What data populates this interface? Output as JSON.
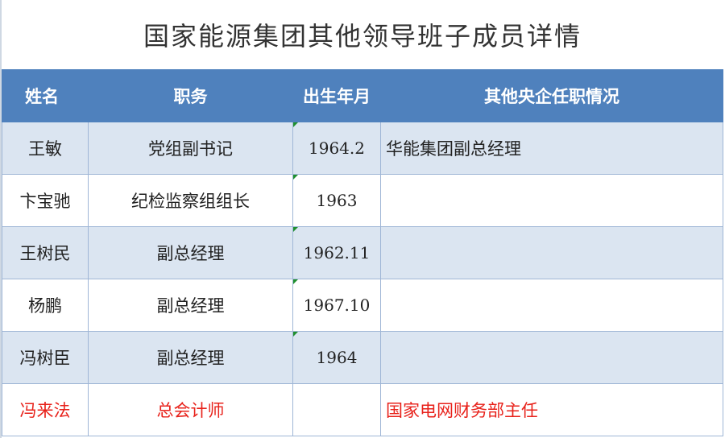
{
  "title": "国家能源集团其他领导班子成员详情",
  "columns": [
    "姓名",
    "职务",
    "出生年月",
    "其他央企任职情况"
  ],
  "rows": [
    {
      "name": "王敏",
      "position": "党组副书记",
      "birth": "1964.2",
      "other": "华能集团副总经理",
      "highlight": false
    },
    {
      "name": "卞宝驰",
      "position": "纪检监察组组长",
      "birth": "1963",
      "other": "",
      "highlight": false
    },
    {
      "name": "王树民",
      "position": "副总经理",
      "birth": "1962.11",
      "other": "",
      "highlight": false
    },
    {
      "name": "杨鹏",
      "position": "副总经理",
      "birth": "1967.10",
      "other": "",
      "highlight": false
    },
    {
      "name": "冯树臣",
      "position": "副总经理",
      "birth": "1964",
      "other": "",
      "highlight": false
    },
    {
      "name": "冯来法",
      "position": "总会计师",
      "birth": "",
      "other": "国家电网财务部主任",
      "highlight": true
    }
  ],
  "colors": {
    "header_bg": "#4f81bd",
    "band_bg": "#dbe5f1",
    "highlight_text": "#e8221b",
    "comment_marker": "#1f8f2e"
  }
}
